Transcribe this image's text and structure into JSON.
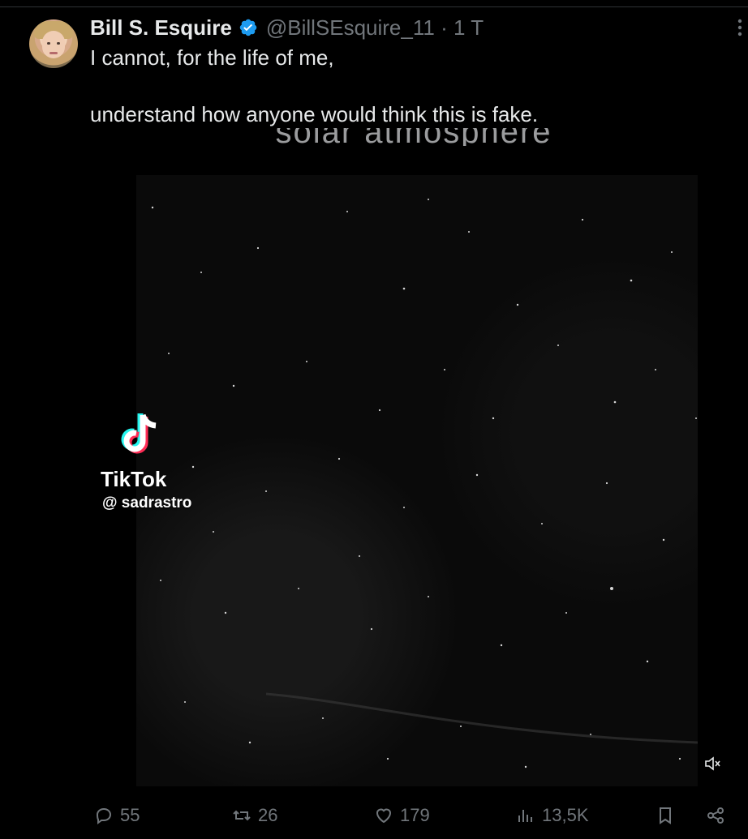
{
  "tweet": {
    "author_name": "Bill S. Esquire",
    "author_handle": "@BillSEsquire_11",
    "separator": "·",
    "age": "1 T",
    "text_line1": "I cannot, for the life of me,",
    "text_line2": "understand how anyone would think this is fake."
  },
  "media": {
    "caption_fragment": "solar atmosphere",
    "watermark_brand": "TikTok",
    "watermark_user": "@ sadrastro",
    "muted": true
  },
  "actions": {
    "replies": "55",
    "reposts": "26",
    "likes": "179",
    "views": "13,5K"
  },
  "colors": {
    "background": "#000000",
    "text": "#e7e9ea",
    "muted_text": "#71767b",
    "verified": "#1d9bf0"
  },
  "icons": [
    "verified-icon",
    "more-icon",
    "tiktok-logo-icon",
    "mute-icon",
    "reply-icon",
    "repost-icon",
    "like-icon",
    "views-icon",
    "bookmark-icon",
    "share-icon"
  ]
}
